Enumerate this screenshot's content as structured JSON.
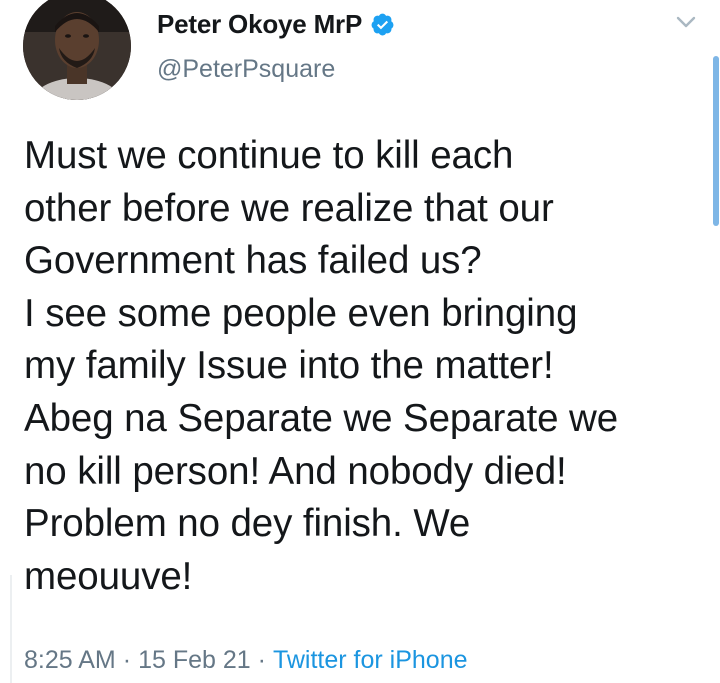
{
  "user": {
    "display_name": "Peter Okoye MrP",
    "handle": "@PeterPsquare",
    "verified": true,
    "avatar_icon": "profile-photo"
  },
  "tweet": {
    "text": "Must we continue to kill each\nother before we realize that our\nGovernment has failed us?\nI see some people even bringing\nmy family Issue into the matter!\nAbeg na Separate we Separate we\nno kill person! And nobody died!\nProblem no dey finish. We\nmeouuve!",
    "time": "8:25 AM",
    "date": "15 Feb 21",
    "separator": "·",
    "source": "Twitter for iPhone"
  },
  "icons": {
    "verified": "verified-badge-icon",
    "more": "chevron-down-icon"
  },
  "colors": {
    "text": "#14171a",
    "secondary": "#657786",
    "link": "#1b95e0",
    "verified": "#1da1f2"
  }
}
